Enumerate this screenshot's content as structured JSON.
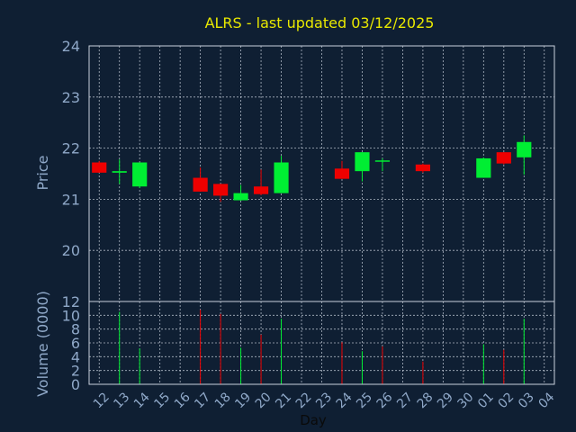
{
  "chart_data": [
    {
      "type": "candlestick",
      "title": "ALRS - last updated 03/12/2025",
      "ylabel": "Price",
      "ylim": [
        19.0,
        24.0
      ],
      "yticks": [
        "20",
        "21",
        "22",
        "23",
        "24"
      ],
      "grid": true,
      "x_labels": [
        "12",
        "13",
        "14",
        "15",
        "16",
        "17",
        "18",
        "19",
        "20",
        "21",
        "22",
        "23",
        "24",
        "25",
        "26",
        "27",
        "28",
        "29",
        "30",
        "01",
        "02",
        "03",
        "04"
      ],
      "colors": {
        "up": "#00ee33",
        "down": "#ee0000"
      },
      "candles": [
        {
          "x": "12",
          "open": 21.72,
          "high": 21.75,
          "low": 21.52,
          "close": 21.52
        },
        {
          "x": "13",
          "open": 21.52,
          "high": 21.78,
          "low": 21.3,
          "close": 21.55
        },
        {
          "x": "14",
          "open": 21.25,
          "high": 21.72,
          "low": 21.22,
          "close": 21.72
        },
        {
          "x": "17",
          "open": 21.42,
          "high": 21.62,
          "low": 21.15,
          "close": 21.15
        },
        {
          "x": "18",
          "open": 21.3,
          "high": 21.3,
          "low": 20.95,
          "close": 21.07
        },
        {
          "x": "19",
          "open": 20.98,
          "high": 21.28,
          "low": 20.97,
          "close": 21.12
        },
        {
          "x": "20",
          "open": 21.25,
          "high": 21.58,
          "low": 21.08,
          "close": 21.1
        },
        {
          "x": "21",
          "open": 21.12,
          "high": 21.85,
          "low": 21.12,
          "close": 21.72
        },
        {
          "x": "24",
          "open": 21.6,
          "high": 21.75,
          "low": 21.4,
          "close": 21.4
        },
        {
          "x": "25",
          "open": 21.55,
          "high": 21.92,
          "low": 21.35,
          "close": 21.92
        },
        {
          "x": "26",
          "open": 21.76,
          "high": 21.8,
          "low": 21.55,
          "close": 21.76
        },
        {
          "x": "28",
          "open": 21.68,
          "high": 21.7,
          "low": 21.52,
          "close": 21.55
        },
        {
          "x": "01",
          "open": 21.42,
          "high": 21.82,
          "low": 21.42,
          "close": 21.8
        },
        {
          "x": "02",
          "open": 21.92,
          "high": 21.92,
          "low": 21.68,
          "close": 21.7
        },
        {
          "x": "03",
          "open": 21.82,
          "high": 22.25,
          "low": 21.48,
          "close": 22.12
        }
      ]
    },
    {
      "type": "bar",
      "ylabel": "Volume (0000)",
      "xlabel": "Day",
      "ylim": [
        0,
        12
      ],
      "yticks": [
        "0",
        "2",
        "4",
        "6",
        "8",
        "10",
        "12"
      ],
      "grid": true,
      "x_labels": [
        "12",
        "13",
        "14",
        "15",
        "16",
        "17",
        "18",
        "19",
        "20",
        "21",
        "22",
        "23",
        "24",
        "25",
        "26",
        "27",
        "28",
        "29",
        "30",
        "01",
        "02",
        "03",
        "04"
      ],
      "bars": [
        {
          "x": "13",
          "value": 10.5,
          "direction": "up"
        },
        {
          "x": "14",
          "value": 5.2,
          "direction": "up"
        },
        {
          "x": "17",
          "value": 10.8,
          "direction": "down"
        },
        {
          "x": "18",
          "value": 10.2,
          "direction": "down"
        },
        {
          "x": "19",
          "value": 5.3,
          "direction": "up"
        },
        {
          "x": "20",
          "value": 7.2,
          "direction": "down"
        },
        {
          "x": "21",
          "value": 9.5,
          "direction": "up"
        },
        {
          "x": "24",
          "value": 6.1,
          "direction": "down"
        },
        {
          "x": "25",
          "value": 4.8,
          "direction": "up"
        },
        {
          "x": "26",
          "value": 5.5,
          "direction": "down"
        },
        {
          "x": "28",
          "value": 3.3,
          "direction": "down"
        },
        {
          "x": "01",
          "value": 5.8,
          "direction": "up"
        },
        {
          "x": "02",
          "value": 5.0,
          "direction": "down"
        },
        {
          "x": "03",
          "value": 9.5,
          "direction": "up"
        }
      ]
    }
  ]
}
